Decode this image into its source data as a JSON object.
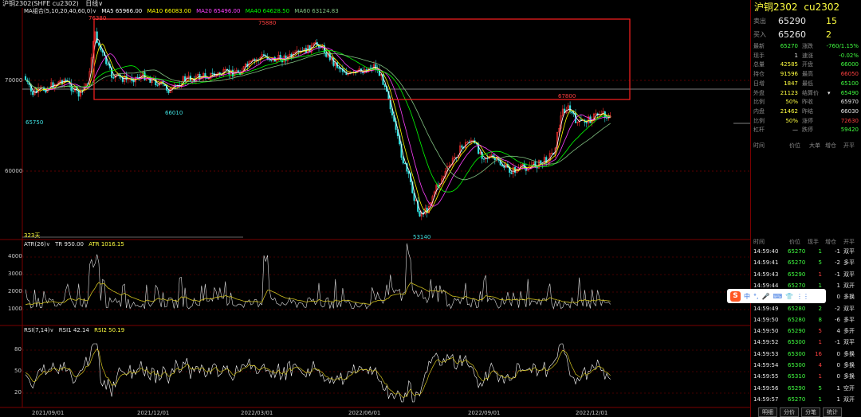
{
  "title_bar": {
    "contract_text": "沪铜2302(SHFE cu2302)",
    "period": "日线",
    "period_arrow": "∨"
  },
  "main_chart": {
    "ma_label": "MA组合(5,10,20,40,60,0)",
    "ma_arrow": "∨",
    "ma5": "MA5 65966.00",
    "ma10": "MA10 66083.00",
    "ma20": "MA20 65496.00",
    "ma40": "MA40 64628.50",
    "ma60": "MA60 63124.83",
    "y_ticks": [
      "70000",
      "60000"
    ],
    "annotations": [
      "76380",
      "75880",
      "65750",
      "66010",
      "67800",
      "53140"
    ],
    "bars_count_label": "323天"
  },
  "atr_panel": {
    "label": "ATR(26)",
    "arrow": "∨",
    "tr": "TR 950.00",
    "atr": "ATR 1016.15",
    "y_ticks": [
      "4000",
      "3000",
      "2000",
      "1000"
    ]
  },
  "rsi_panel": {
    "label": "RSI(7,14)",
    "arrow": "∨",
    "rsi1": "RSI1 42.14",
    "rsi2": "RSI2 50.19",
    "y_ticks": [
      "80",
      "50",
      "20"
    ]
  },
  "x_axis": [
    "2021/09/01",
    "2021/12/01",
    "2022/03/01",
    "2022/06/01",
    "2022/09/01",
    "2022/12/01"
  ],
  "quote": {
    "name": "沪铜2302",
    "code": "cu2302",
    "ask_label": "卖出",
    "ask_price": "65290",
    "ask_vol": "15",
    "bid_label": "买入",
    "bid_price": "65260",
    "bid_vol": "2",
    "rows": [
      {
        "l1": "最新",
        "v1": "65270",
        "c1": "g",
        "l2": "涨跌",
        "v2": "-760/1.15%",
        "c2": "g"
      },
      {
        "l1": "现手",
        "v1": "1",
        "c1": "w",
        "l2": "速涨",
        "v2": "-0.02%",
        "c2": "g"
      },
      {
        "l1": "总量",
        "v1": "42585",
        "c1": "y",
        "l2": "开盘",
        "v2": "66000",
        "c2": "g"
      },
      {
        "l1": "持仓",
        "v1": "91596",
        "c1": "y",
        "l2": "最高",
        "v2": "66050",
        "c2": "r"
      },
      {
        "l1": "日增",
        "v1": "1847",
        "c1": "y",
        "l2": "最低",
        "v2": "65100",
        "c2": "g"
      },
      {
        "l1": "外盘",
        "v1": "21123",
        "c1": "y",
        "l2": "结算价",
        "v2": "65490",
        "c2": "g"
      },
      {
        "l1": "比例",
        "v1": "50%",
        "c1": "y",
        "l2": "昨收",
        "v2": "65970",
        "c2": "w"
      },
      {
        "l1": "内盘",
        "v1": "21462",
        "c1": "y",
        "l2": "昨结",
        "v2": "66030",
        "c2": "w"
      },
      {
        "l1": "比例",
        "v1": "50%",
        "c1": "y",
        "l2": "涨停",
        "v2": "72630",
        "c2": "r"
      },
      {
        "l1": "杠杆",
        "v1": "—",
        "c1": "w",
        "l2": "跌停",
        "v2": "59420",
        "c2": "g"
      }
    ],
    "settle_arrow": "▾"
  },
  "tick_header1": {
    "time": "时间",
    "price": "价位",
    "vol": "大单",
    "oi": "增仓",
    "type": "开平"
  },
  "tick_header2": {
    "time": "时间",
    "price": "价位",
    "vol": "现手",
    "oi": "增仓",
    "type": "开平"
  },
  "ticks": [
    {
      "time": "14:59:40",
      "price": "65270",
      "pc": "g",
      "vol": "1",
      "vc": "g",
      "oi": "-1",
      "type": "双平",
      "tc": "w"
    },
    {
      "time": "14:59:41",
      "price": "65270",
      "pc": "g",
      "vol": "5",
      "vc": "g",
      "oi": "-2",
      "type": "多平",
      "tc": "w"
    },
    {
      "time": "14:59:43",
      "price": "65290",
      "pc": "g",
      "vol": "1",
      "vc": "r",
      "oi": "-1",
      "type": "双平",
      "tc": "w"
    },
    {
      "time": "14:59:44",
      "price": "65270",
      "pc": "g",
      "vol": "1",
      "vc": "g",
      "oi": "1",
      "type": "双开",
      "tc": "w"
    },
    {
      "time": "14:59:48",
      "price": "65290",
      "pc": "g",
      "vol": "2",
      "vc": "r",
      "oi": "0",
      "type": "多换",
      "tc": "w"
    },
    {
      "time": "14:59:49",
      "price": "65280",
      "pc": "g",
      "vol": "2",
      "vc": "g",
      "oi": "-2",
      "type": "双平",
      "tc": "w"
    },
    {
      "time": "14:59:50",
      "price": "65280",
      "pc": "g",
      "vol": "8",
      "vc": "g",
      "oi": "-6",
      "type": "多平",
      "tc": "w"
    },
    {
      "time": "14:59:50",
      "price": "65290",
      "pc": "g",
      "vol": "5",
      "vc": "r",
      "oi": "4",
      "type": "多开",
      "tc": "w"
    },
    {
      "time": "14:59:52",
      "price": "65300",
      "pc": "g",
      "vol": "1",
      "vc": "r",
      "oi": "-1",
      "type": "双平",
      "tc": "w"
    },
    {
      "time": "14:59:53",
      "price": "65300",
      "pc": "g",
      "vol": "16",
      "vc": "r",
      "oi": "0",
      "type": "多换",
      "tc": "w"
    },
    {
      "time": "14:59:54",
      "price": "65300",
      "pc": "g",
      "vol": "4",
      "vc": "r",
      "oi": "0",
      "type": "多换",
      "tc": "w"
    },
    {
      "time": "14:59:55",
      "price": "65310",
      "pc": "g",
      "vol": "1",
      "vc": "r",
      "oi": "0",
      "type": "多换",
      "tc": "w"
    },
    {
      "time": "14:59:56",
      "price": "65290",
      "pc": "g",
      "vol": "5",
      "vc": "g",
      "oi": "1",
      "type": "空开",
      "tc": "w"
    },
    {
      "time": "14:59:57",
      "price": "65270",
      "pc": "g",
      "vol": "1",
      "vc": "g",
      "oi": "1",
      "type": "双开",
      "tc": "w"
    }
  ],
  "tabs": [
    "明细",
    "分价",
    "分笔",
    "统计"
  ],
  "ime": {
    "logo": "S",
    "lang": "中",
    "items": [
      "°,",
      "🎤",
      "⌨",
      "👕",
      "⋮⋮"
    ]
  },
  "colors": {
    "up": "#ff3030",
    "down": "#30e0e0",
    "ma5": "#ffffff",
    "ma10": "#ffff00",
    "ma20": "#ff40ff",
    "ma40": "#00ff00",
    "ma60": "#80c080",
    "frame": "#7a0000",
    "highlight_box": "#ff2020"
  }
}
